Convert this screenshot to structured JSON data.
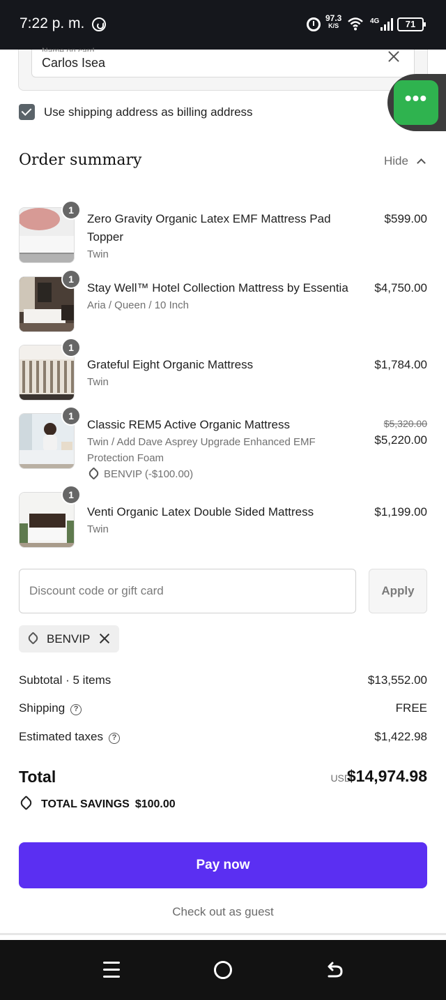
{
  "status_bar": {
    "time": "7:22 p. m.",
    "net_speed": "97.3",
    "net_speed_unit": "K/S",
    "network_type": "4G",
    "battery": "71"
  },
  "payment": {
    "name_label": "Name on card",
    "name_value": "Carlos Isea"
  },
  "billing": {
    "checked": true,
    "label": "Use shipping address as billing address"
  },
  "summary": {
    "title": "Order summary",
    "hide_label": "Hide"
  },
  "items": [
    {
      "qty": "1",
      "name": "Zero Gravity Organic Latex EMF Mattress Pad Topper",
      "variant": "Twin",
      "price": "$599.00"
    },
    {
      "qty": "1",
      "name": "Stay Well™ Hotel Collection Mattress by Essentia",
      "variant": "Aria / Queen / 10 Inch",
      "price": "$4,750.00"
    },
    {
      "qty": "1",
      "name": "Grateful Eight Organic Mattress",
      "variant": "Twin",
      "price": "$1,784.00"
    },
    {
      "qty": "1",
      "name": "Classic REM5 Active Organic Mattress",
      "variant": "Twin / Add Dave Asprey Upgrade Enhanced EMF Protection Foam",
      "discount": "BENVIP (-$100.00)",
      "original_price": "$5,320.00",
      "price": "$5,220.00"
    },
    {
      "qty": "1",
      "name": "Venti Organic Latex Double Sided Mattress",
      "variant": "Twin",
      "price": "$1,199.00"
    }
  ],
  "discount": {
    "placeholder": "Discount code or gift card",
    "apply_label": "Apply",
    "applied_code": "BENVIP"
  },
  "costs": {
    "subtotal_label": "Subtotal · 5 items",
    "subtotal_value": "$13,552.00",
    "shipping_label": "Shipping",
    "shipping_value": "FREE",
    "taxes_label": "Estimated taxes",
    "taxes_value": "$1,422.98",
    "total_label": "Total",
    "currency": "USD",
    "total_value": "$14,974.98",
    "savings_label": "TOTAL SAVINGS",
    "savings_value": "$100.00"
  },
  "actions": {
    "pay_label": "Pay now",
    "guest_label": "Check out as guest"
  },
  "colors": {
    "pay_button": "#5b2ff2",
    "chat_bubble": "#2fb34f",
    "checkbox": "#5a6369"
  }
}
